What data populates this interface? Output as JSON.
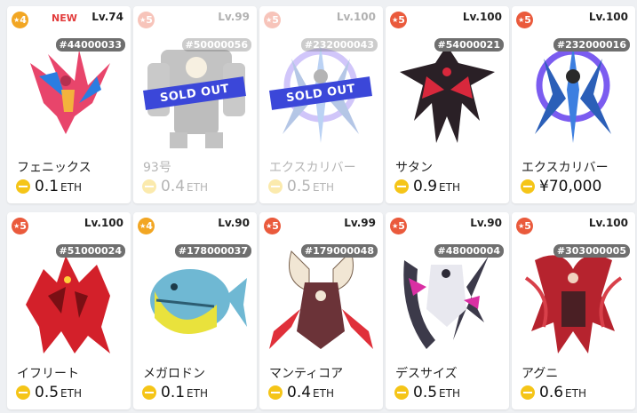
{
  "colors": {
    "rarity4": "#f2a623",
    "rarity5": "#ea5a3c",
    "sold_banner": "#3b47d9",
    "coin": "#f5c518"
  },
  "cards": [
    {
      "rarity": "4",
      "new": "NEW",
      "level": "Lv.74",
      "id": "#44000033",
      "name": "フェニックス",
      "price": "0.1",
      "unit": "ETH",
      "sold": "",
      "art": "phoenix-art"
    },
    {
      "rarity": "5",
      "new": "",
      "level": "Lv.99",
      "id": "#50000056",
      "name": "93号",
      "price": "0.4",
      "unit": "ETH",
      "sold": "SOLD OUT",
      "art": "robot-art"
    },
    {
      "rarity": "5",
      "new": "",
      "level": "Lv.100",
      "id": "#232000043",
      "name": "エクスカリバー",
      "price": "0.5",
      "unit": "ETH",
      "sold": "SOLD OUT",
      "art": "excalibur-art"
    },
    {
      "rarity": "5",
      "new": "",
      "level": "Lv.100",
      "id": "#54000021",
      "name": "サタン",
      "price": "0.9",
      "unit": "ETH",
      "sold": "",
      "art": "satan-art"
    },
    {
      "rarity": "5",
      "new": "",
      "level": "Lv.100",
      "id": "#232000016",
      "name": "エクスカリバー",
      "price": "¥70,000",
      "unit": "",
      "sold": "",
      "art": "excalibur-art"
    },
    {
      "rarity": "5",
      "new": "",
      "level": "Lv.100",
      "id": "#51000024",
      "name": "イフリート",
      "price": "0.5",
      "unit": "ETH",
      "sold": "",
      "art": "ifrit-art"
    },
    {
      "rarity": "4",
      "new": "",
      "level": "Lv.90",
      "id": "#178000037",
      "name": "メガロドン",
      "price": "0.1",
      "unit": "ETH",
      "sold": "",
      "art": "megalodon-art"
    },
    {
      "rarity": "5",
      "new": "",
      "level": "Lv.99",
      "id": "#179000048",
      "name": "マンティコア",
      "price": "0.4",
      "unit": "ETH",
      "sold": "",
      "art": "manticore-art"
    },
    {
      "rarity": "5",
      "new": "",
      "level": "Lv.90",
      "id": "#48000004",
      "name": "デスサイズ",
      "price": "0.5",
      "unit": "ETH",
      "sold": "",
      "art": "deathscythe-art"
    },
    {
      "rarity": "5",
      "new": "",
      "level": "Lv.100",
      "id": "#303000005",
      "name": "アグニ",
      "price": "0.6",
      "unit": "ETH",
      "sold": "",
      "art": "agni-art"
    }
  ]
}
